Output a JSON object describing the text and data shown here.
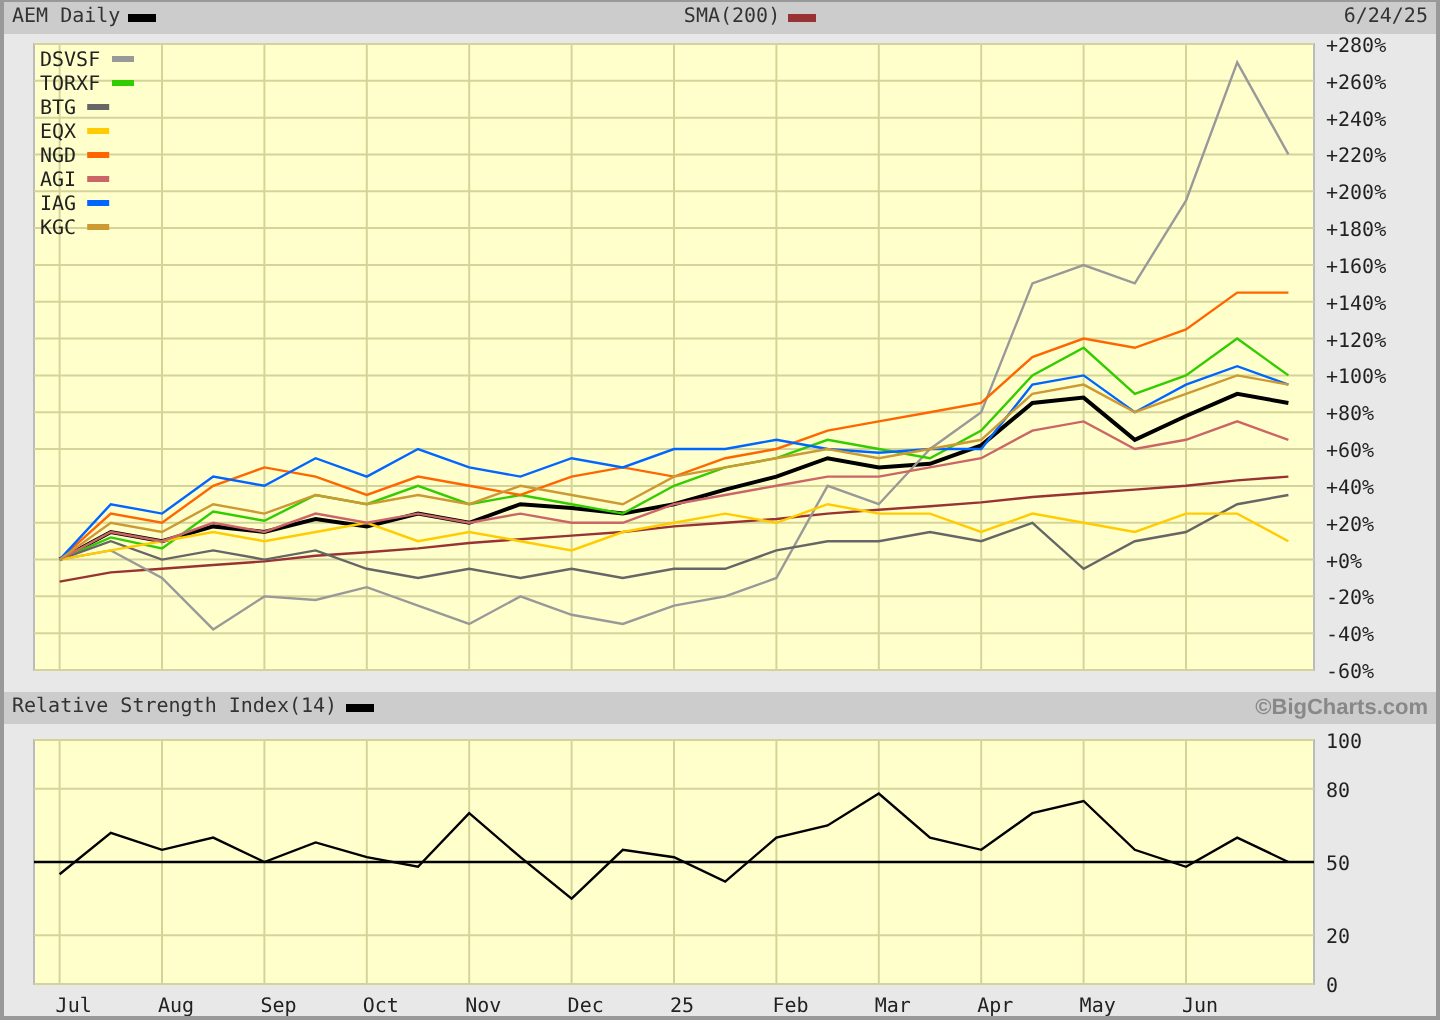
{
  "header": {
    "date": "6/24/25"
  },
  "price_chart": {
    "chart_data": {
      "type": "line",
      "grid": true,
      "legend": true,
      "categories": [
        null,
        null,
        null,
        null,
        null,
        null,
        null,
        null,
        null,
        null,
        null,
        null,
        null,
        null,
        null,
        null,
        null,
        null,
        null,
        null,
        null,
        null,
        null,
        null,
        null
      ],
      "ylim": [
        -60,
        280
      ],
      "yticks": [
        {
          "value": 280,
          "label": "+280%"
        },
        {
          "value": 260,
          "label": "+260%"
        },
        {
          "value": 240,
          "label": "+240%"
        },
        {
          "value": 220,
          "label": "+220%"
        },
        {
          "value": 200,
          "label": "+200%"
        },
        {
          "value": 180,
          "label": "+180%"
        },
        {
          "value": 160,
          "label": "+160%"
        },
        {
          "value": 140,
          "label": "+140%"
        },
        {
          "value": 120,
          "label": "+120%"
        },
        {
          "value": 100,
          "label": "+100%"
        },
        {
          "value": 80,
          "label": "+80%"
        },
        {
          "value": 60,
          "label": "+60%"
        },
        {
          "value": 40,
          "label": "+40%"
        },
        {
          "value": 20,
          "label": "+20%"
        },
        {
          "value": 0,
          "label": "+0%"
        },
        {
          "value": -20,
          "label": "-20%"
        },
        {
          "value": -40,
          "label": "-40%"
        },
        {
          "value": -60,
          "label": "-60%"
        }
      ],
      "series": [
        {
          "name": "AEM Daily",
          "color": "#000000",
          "values": [
            0,
            15,
            10,
            18,
            15,
            22,
            18,
            25,
            20,
            30,
            28,
            25,
            30,
            38,
            45,
            55,
            50,
            52,
            62,
            85,
            88,
            65,
            78,
            90,
            85
          ]
        },
        {
          "name": "SMA(200)",
          "color": "#993333",
          "values": [
            -12,
            -7,
            -5,
            -3,
            -1,
            2,
            4,
            6,
            9,
            11,
            13,
            15,
            18,
            20,
            22,
            25,
            27,
            29,
            31,
            34,
            36,
            38,
            40,
            43,
            45
          ]
        },
        {
          "name": "DSVSF",
          "color": "#999999",
          "values": [
            0,
            5,
            -10,
            -38,
            -20,
            -22,
            -15,
            -25,
            -35,
            -20,
            -30,
            -35,
            -25,
            -20,
            -10,
            40,
            30,
            60,
            80,
            150,
            160,
            150,
            195,
            270,
            220
          ]
        },
        {
          "name": "TORXF",
          "color": "#33cc00",
          "values": [
            0,
            12,
            6,
            26,
            21,
            35,
            30,
            40,
            30,
            35,
            30,
            25,
            40,
            50,
            55,
            65,
            60,
            55,
            70,
            100,
            115,
            90,
            100,
            120,
            100
          ]
        },
        {
          "name": "BTG",
          "color": "#666666",
          "values": [
            0,
            10,
            0,
            5,
            0,
            5,
            -5,
            -10,
            -5,
            -10,
            -5,
            -10,
            -5,
            -5,
            5,
            10,
            10,
            15,
            10,
            20,
            -5,
            10,
            15,
            30,
            35
          ]
        },
        {
          "name": "EQX",
          "color": "#ffcc00",
          "values": [
            0,
            5,
            10,
            15,
            10,
            15,
            20,
            10,
            15,
            10,
            5,
            15,
            20,
            25,
            20,
            30,
            25,
            25,
            15,
            25,
            20,
            15,
            25,
            25,
            10
          ]
        },
        {
          "name": "NGD",
          "color": "#ff6600",
          "values": [
            0,
            25,
            20,
            40,
            50,
            45,
            35,
            45,
            40,
            35,
            45,
            50,
            45,
            55,
            60,
            70,
            75,
            80,
            85,
            110,
            120,
            115,
            125,
            145,
            145
          ]
        },
        {
          "name": "AGI",
          "color": "#cc6666",
          "values": [
            0,
            15,
            10,
            20,
            15,
            25,
            20,
            25,
            20,
            25,
            20,
            20,
            30,
            35,
            40,
            45,
            45,
            50,
            55,
            70,
            75,
            60,
            65,
            75,
            65
          ]
        },
        {
          "name": "IAG",
          "color": "#0066ff",
          "values": [
            0,
            30,
            25,
            45,
            40,
            55,
            45,
            60,
            50,
            45,
            55,
            50,
            60,
            60,
            65,
            60,
            58,
            60,
            60,
            95,
            100,
            80,
            95,
            105,
            95
          ]
        },
        {
          "name": "KGC",
          "color": "#cc9933",
          "values": [
            0,
            20,
            15,
            30,
            25,
            35,
            30,
            35,
            30,
            40,
            35,
            30,
            45,
            50,
            55,
            60,
            55,
            60,
            65,
            90,
            95,
            80,
            90,
            100,
            95
          ]
        }
      ]
    }
  },
  "rsi_panel": {
    "credit": "©BigCharts.com",
    "chart_data": {
      "type": "line",
      "grid": true,
      "categories": [
        "Jul",
        null,
        "Aug",
        null,
        "Sep",
        null,
        "Oct",
        null,
        "Nov",
        null,
        "Dec",
        null,
        "25",
        null,
        "Feb",
        null,
        "Mar",
        null,
        "Apr",
        null,
        "May",
        null,
        "Jun",
        null,
        null
      ],
      "ylim": [
        0,
        100
      ],
      "yticks": [
        0,
        20,
        50,
        80,
        100
      ],
      "ref_lines": [
        {
          "axis": "y",
          "value": 50
        }
      ],
      "series": [
        {
          "name": "Relative Strength Index(14)",
          "color": "#000000",
          "values": [
            45,
            62,
            55,
            60,
            50,
            58,
            52,
            48,
            70,
            52,
            35,
            55,
            52,
            42,
            60,
            65,
            78,
            60,
            55,
            70,
            75,
            55,
            48,
            60,
            50
          ]
        }
      ]
    }
  }
}
